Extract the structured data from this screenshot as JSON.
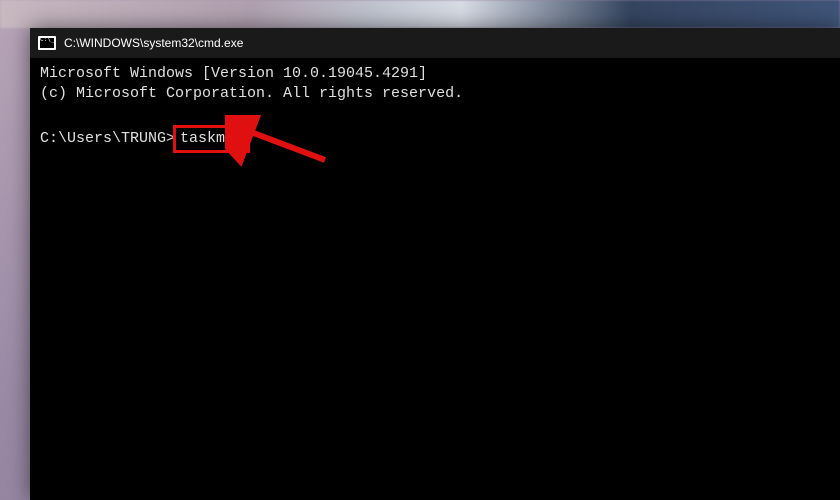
{
  "window": {
    "title": "C:\\WINDOWS\\system32\\cmd.exe"
  },
  "terminal": {
    "line1": "Microsoft Windows [Version 10.0.19045.4291]",
    "line2": "(c) Microsoft Corporation. All rights reserved.",
    "prompt": "C:\\Users\\TRUNG>",
    "command": "taskmgr"
  },
  "annotation": {
    "highlight_color": "#e01010",
    "arrow_color": "#e01010"
  }
}
